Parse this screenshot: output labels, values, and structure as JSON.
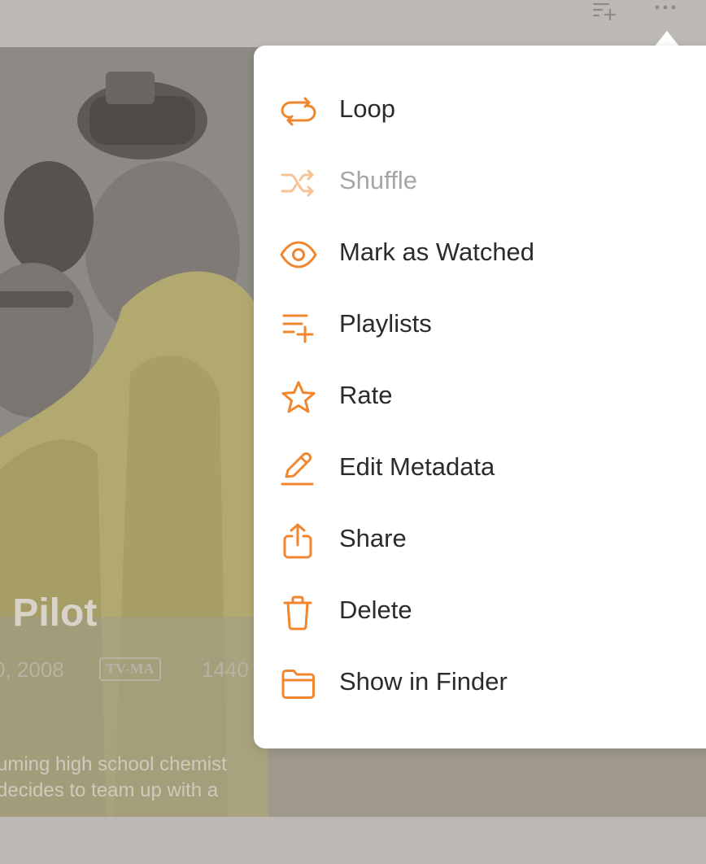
{
  "toolbar": {
    "add_to_playlist_icon": "playlist-add-icon",
    "more_icon": "more-icon"
  },
  "episode": {
    "title": "- Pilot",
    "date": "0, 2008",
    "rating": "TV-MA",
    "resolution": "1440",
    "synopsis_line1": "uming high school chemist",
    "synopsis_line2": "decides to team up with a"
  },
  "menu": {
    "accent_color": "#f0862d",
    "items": [
      {
        "label": "Loop",
        "icon": "loop-icon",
        "enabled": true
      },
      {
        "label": "Shuffle",
        "icon": "shuffle-icon",
        "enabled": false
      },
      {
        "label": "Mark as Watched",
        "icon": "eye-icon",
        "enabled": true
      },
      {
        "label": "Playlists",
        "icon": "playlist-add-icon",
        "enabled": true
      },
      {
        "label": "Rate",
        "icon": "star-icon",
        "enabled": true
      },
      {
        "label": "Edit Metadata",
        "icon": "pencil-icon",
        "enabled": true
      },
      {
        "label": "Share",
        "icon": "share-icon",
        "enabled": true
      },
      {
        "label": "Delete",
        "icon": "trash-icon",
        "enabled": true
      },
      {
        "label": "Show in Finder",
        "icon": "folder-icon",
        "enabled": true
      }
    ]
  }
}
